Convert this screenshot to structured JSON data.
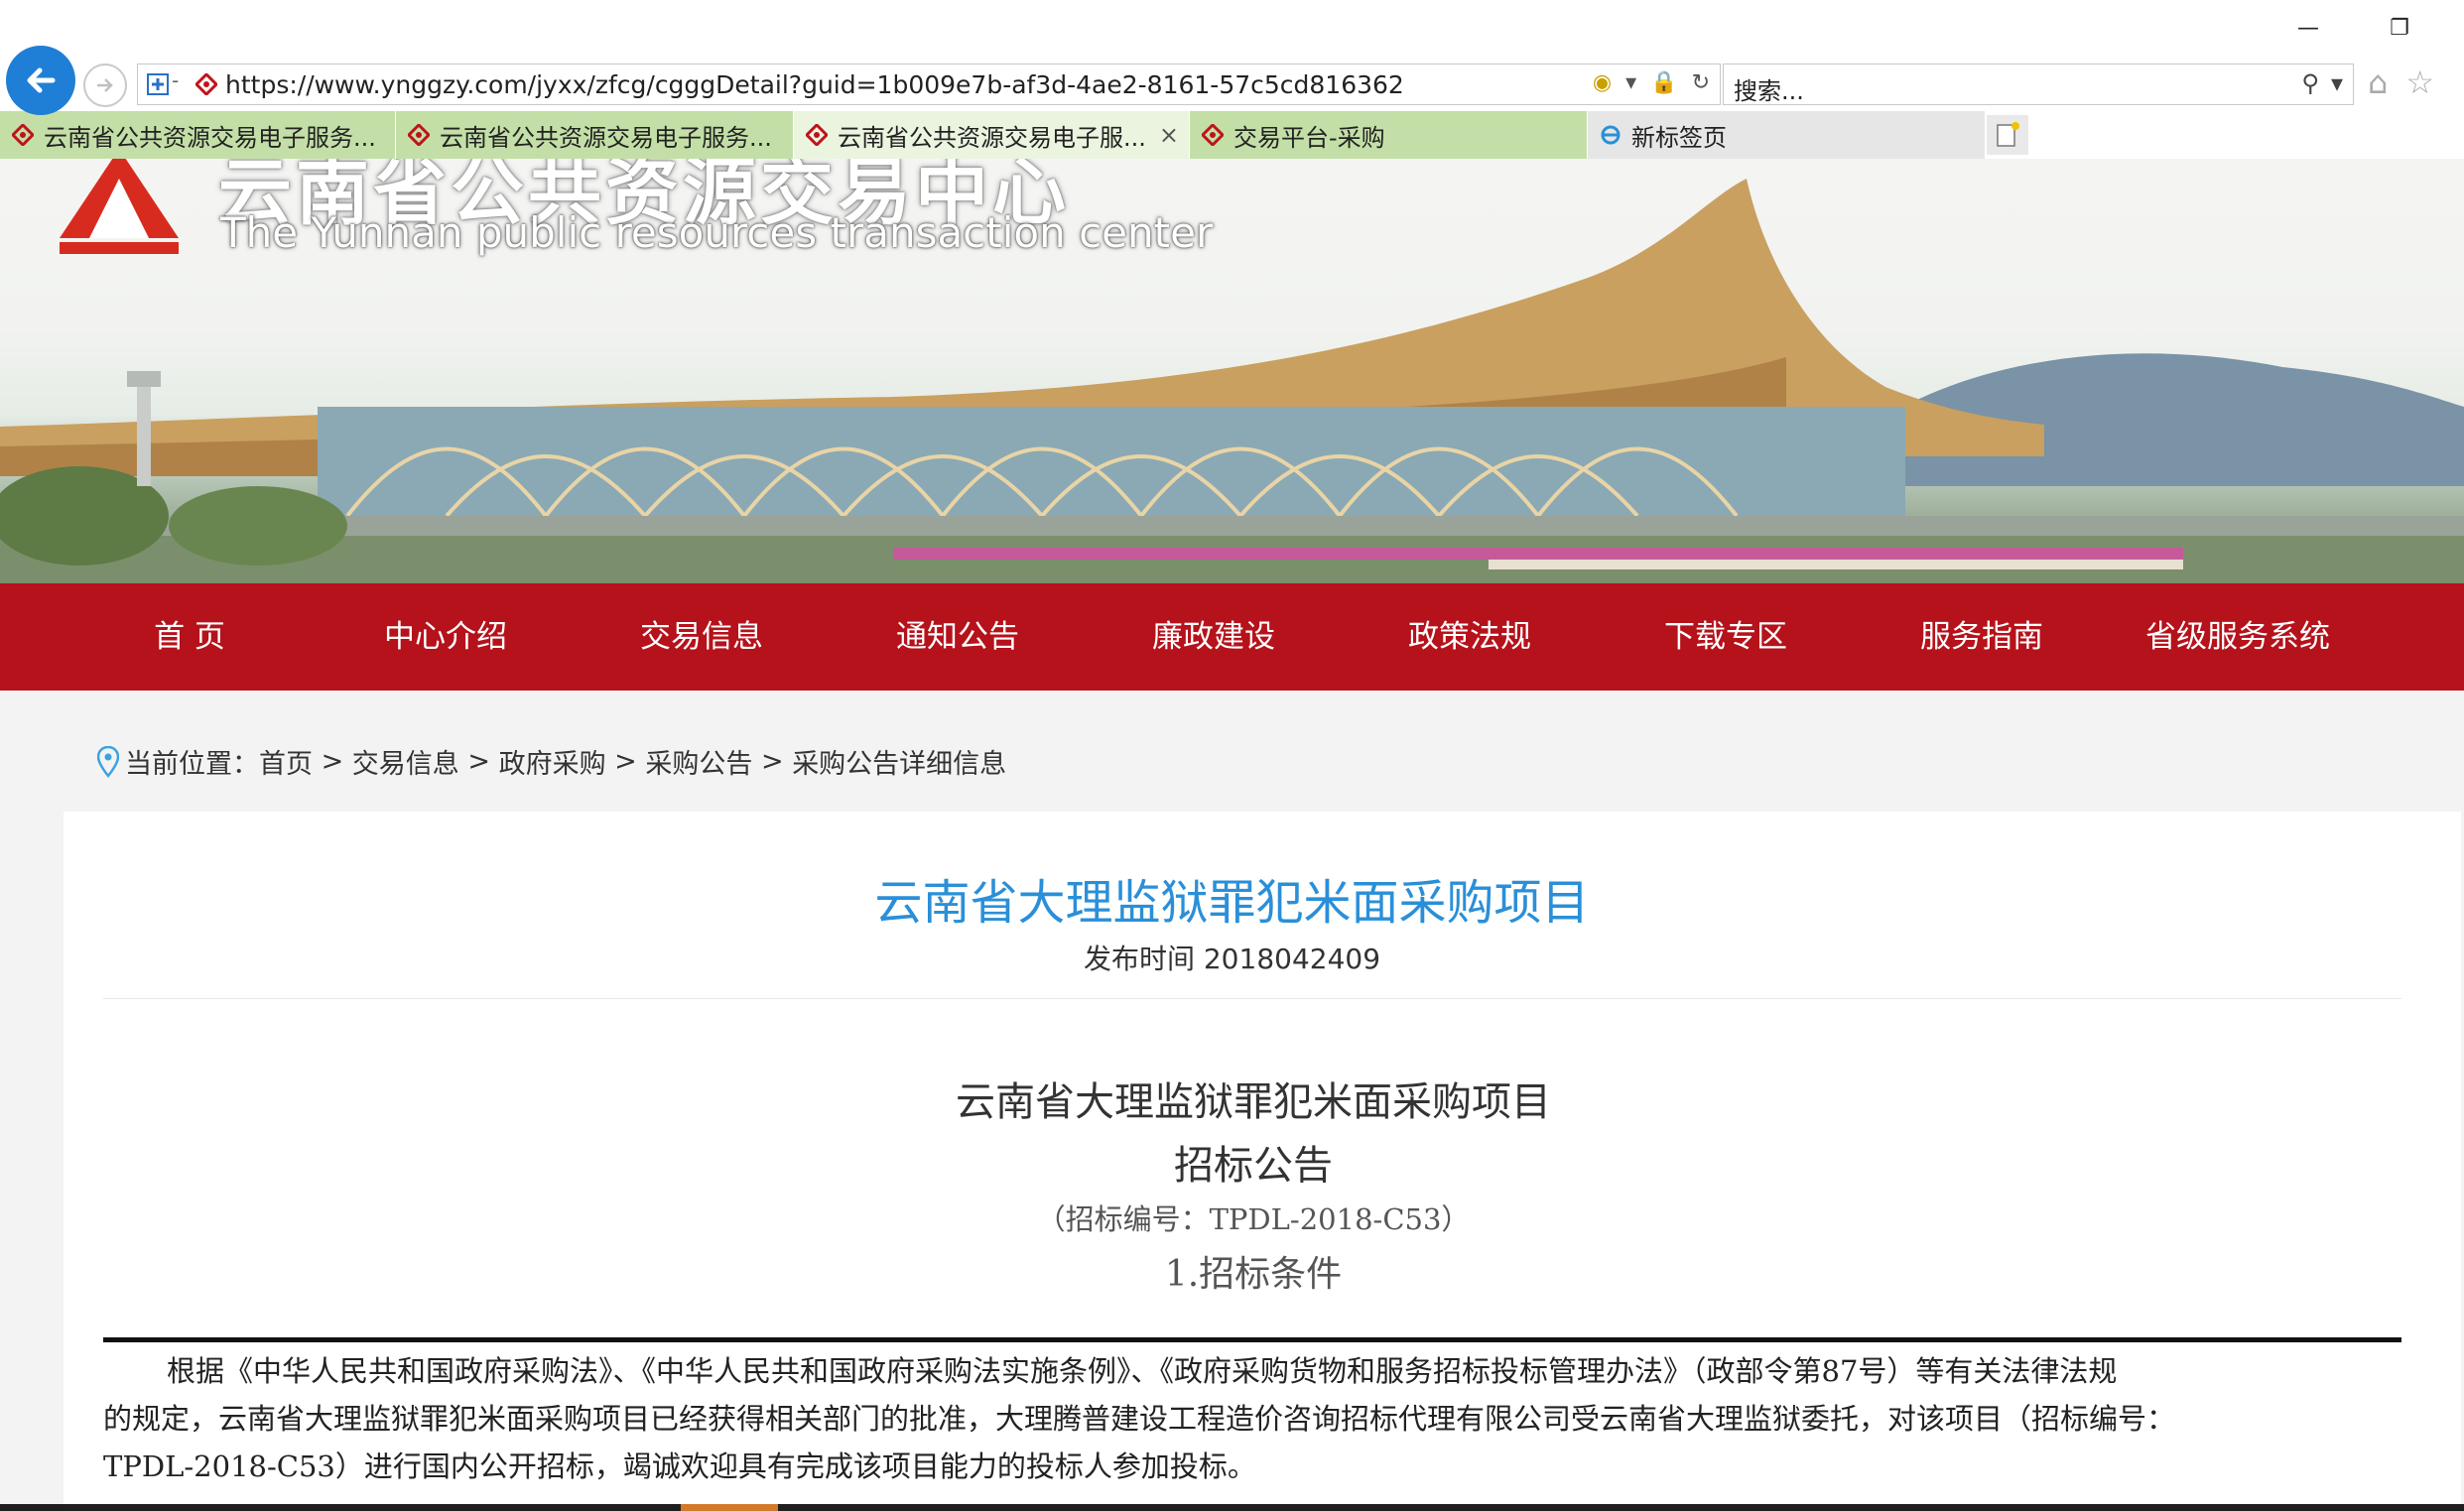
{
  "browser": {
    "url": "https://www.ynggzy.com/jyxx/zfcg/cgggDetail?guid=1b009e7b-af3d-4ae2-8161-57c5cd816362",
    "search_placeholder": "搜索...",
    "tabs": [
      {
        "label": "云南省公共资源交易电子服务..."
      },
      {
        "label": "云南省公共资源交易电子服务..."
      },
      {
        "label": "云南省公共资源交易电子服...",
        "close": "×"
      },
      {
        "label": "交易平台-采购"
      },
      {
        "label": "新标签页"
      }
    ],
    "minimize": "—",
    "restore": "❐"
  },
  "banner": {
    "cn_title": "云南省公共资源交易中心",
    "en_title": "The Yunnan public resources transaction center"
  },
  "nav": [
    {
      "label": "首 页"
    },
    {
      "label": "中心介绍"
    },
    {
      "label": "交易信息"
    },
    {
      "label": "通知公告"
    },
    {
      "label": "廉政建设"
    },
    {
      "label": "政策法规"
    },
    {
      "label": "下载专区"
    },
    {
      "label": "服务指南"
    },
    {
      "label": "省级服务系统"
    }
  ],
  "breadcrumb": {
    "prefix": "当前位置：",
    "items": [
      "首页",
      "交易信息",
      "政府采购",
      "采购公告",
      "采购公告详细信息"
    ],
    "separator": " > "
  },
  "article": {
    "title": "云南省大理监狱罪犯米面采购项目",
    "publish_time": "发布时间 2018042409",
    "doc_title": "云南省大理监狱罪犯米面采购项目",
    "doc_subtitle": "招标公告",
    "doc_number": "（招标编号：TPDL-2018-C53）",
    "section1": "1.招标条件",
    "para_lines": [
      "根据《中华人民共和国政府采购法》、《中华人民共和国政府采购法实施条例》、《政府采购货物和服务招标投标管理办法》（政部令第87号）等有关法律法规",
      "的规定，云南省大理监狱罪犯米面采购项目已经获得相关部门的批准，大理腾普建设工程造价咨询招标代理有限公司受云南省大理监狱委托，对该项目（招标编号：",
      "TPDL-2018-C53）进行国内公开招标，竭诚欢迎具有完成该项目能力的投标人参加投标。"
    ]
  },
  "colors": {
    "nav_red": "#b5121b",
    "title_blue": "#2a8fd8",
    "tab_green": "#c3dfa7"
  }
}
